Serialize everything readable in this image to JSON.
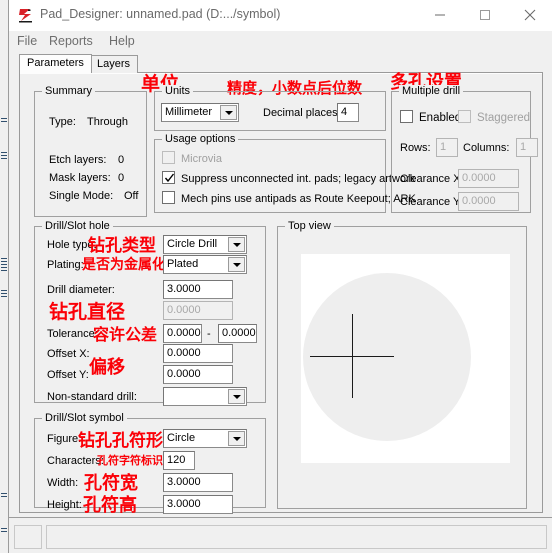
{
  "window": {
    "title": "Pad_Designer: unnamed.pad (D:.../symbol)",
    "app_icon": "pad-designer-icon",
    "minimize_label": "—",
    "maximize_label": "□",
    "close_label": "✕"
  },
  "menubar": {
    "items": [
      {
        "label": "File"
      },
      {
        "label": "Reports"
      },
      {
        "label": "Help"
      }
    ]
  },
  "tabs": [
    {
      "label": "Parameters",
      "active": true
    },
    {
      "label": "Layers",
      "active": false
    }
  ],
  "summary": {
    "legend": "Summary",
    "rows": [
      {
        "label": "Type:",
        "value": "Through"
      },
      {
        "label": "Etch layers:",
        "value": "0"
      },
      {
        "label": "Mask layers:",
        "value": "0"
      },
      {
        "label": "Single Mode:",
        "value": "Off"
      }
    ]
  },
  "units": {
    "legend": "Units",
    "annotation": "单位",
    "unit_value": "Millimeter",
    "decimal_label": "Decimal places:",
    "decimal_value": "4",
    "decimal_annotation": "精度，小数点后位数"
  },
  "usage_options": {
    "legend": "Usage options",
    "items": [
      {
        "label": "Microvia",
        "checked": false,
        "disabled": true
      },
      {
        "label": "Suppress unconnected int. pads; legacy artwork",
        "checked": true,
        "disabled": false
      },
      {
        "label": "Mech pins use antipads as Route Keepout; ARK",
        "checked": false,
        "disabled": false
      }
    ]
  },
  "multiple_drill": {
    "legend": "Multiple drill",
    "annotation": "多孔设置",
    "enabled_label": "Enabled",
    "enabled_checked": false,
    "staggered_label": "Staggered",
    "staggered_checked": false,
    "staggered_disabled": true,
    "rows_label": "Rows:",
    "rows_value": "1",
    "columns_label": "Columns:",
    "columns_value": "1",
    "clearance_x_label": "Clearance X:",
    "clearance_x_value": "0.0000",
    "clearance_y_label": "Clearance Y:",
    "clearance_y_value": "0.0000"
  },
  "drill_slot_hole": {
    "legend": "Drill/Slot hole",
    "hole_type_label": "Hole type:",
    "hole_type_annotation": "钻孔类型",
    "hole_type_value": "Circle Drill",
    "plating_label": "Plating:",
    "plating_annotation": "是否为金属化孔",
    "plating_value": "Plated",
    "drill_diameter_label": "Drill diameter:",
    "drill_diameter_annotation": "钻孔直径",
    "drill_diameter_value": "3.0000",
    "drill_secondary_value": "0.0000",
    "tolerance_label": "Tolerance:",
    "tolerance_annotation": "容许公差",
    "tolerance_min": "0.0000",
    "tolerance_sep": "-",
    "tolerance_max": "0.0000",
    "offset_x_label": "Offset X:",
    "offset_x_value": "0.0000",
    "offset_y_label": "Offset Y:",
    "offset_y_value": "0.0000",
    "offset_annotation": "偏移",
    "non_standard_label": "Non-standard drill:",
    "non_standard_value": ""
  },
  "drill_slot_symbol": {
    "legend": "Drill/Slot symbol",
    "figure_label": "Figure:",
    "figure_annotation": "钻孔孔符形状",
    "figure_value": "Circle",
    "characters_label": "Characters:",
    "characters_annotation": "孔符字符标识",
    "characters_value": "120",
    "width_label": "Width:",
    "width_annotation": "孔符宽",
    "width_value": "3.0000",
    "height_label": "Height:",
    "height_annotation": "孔符高",
    "height_value": "3.0000"
  },
  "top_view": {
    "legend": "Top view",
    "shape": "circle",
    "pad_color": "#eeeeee",
    "background_color": "#ffffff",
    "crosshair_color": "#1a1a1a"
  },
  "statusbar": {
    "left_pane_text": "",
    "right_pane_text": ""
  },
  "colors": {
    "annotation_red": "#fb0007",
    "window_face": "#f0f0f0",
    "field_bg": "#ffffff",
    "disabled_text": "#a8a8a8"
  }
}
